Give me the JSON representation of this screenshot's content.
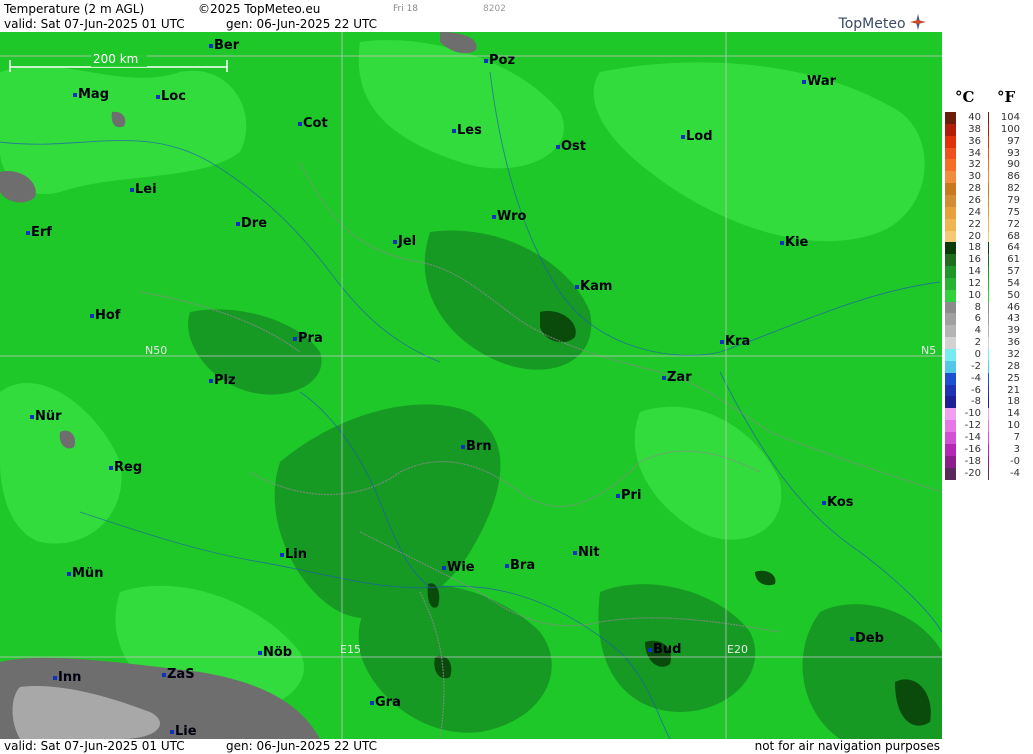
{
  "header": {
    "title": "Temperature (2 m AGL)",
    "copyright": "©2025 TopMeteo.eu",
    "day_tag": "Fri 18",
    "code": "8202",
    "valid": "valid:  Sat  07-Jun-2025  01 UTC",
    "generated": "gen: 06-Jun-2025 22 UTC",
    "brand": "TopMeteo"
  },
  "footer": {
    "valid": "valid:  Sat  07-Jun-2025  01 UTC",
    "generated": "gen: 06-Jun-2025 22 UTC",
    "disclaimer": "not for air navigation purposes"
  },
  "map": {
    "scale_label": "200 km",
    "grid_labels": {
      "lat": "N50",
      "lat_right": "N5",
      "lon1": "E15",
      "lon2": "E20"
    },
    "cities": [
      "Ber",
      "Poz",
      "War",
      "Mag",
      "Loc",
      "Cot",
      "Les",
      "Ost",
      "Lod",
      "Lei",
      "Dre",
      "Wro",
      "Erf",
      "Jel",
      "Kie",
      "Kam",
      "Hof",
      "Pra",
      "Kra",
      "Plz",
      "Zar",
      "Nür",
      "Brn",
      "Reg",
      "Pri",
      "Kos",
      "Lin",
      "Nit",
      "Mün",
      "Wie",
      "Bra",
      "Nöb",
      "Bud",
      "Deb",
      "Inn",
      "ZaS",
      "Gra",
      "Lie"
    ]
  },
  "legend": {
    "unit_c": "°C",
    "unit_f": "°F",
    "celsius": [
      "40",
      "38",
      "36",
      "34",
      "32",
      "30",
      "28",
      "26",
      "24",
      "22",
      "20",
      "18",
      "16",
      "14",
      "12",
      "10",
      "8",
      "6",
      "4",
      "2",
      "0",
      "-2",
      "-4",
      "-6",
      "-8",
      "-10",
      "-12",
      "-14",
      "-16",
      "-18",
      "-20"
    ],
    "fahrenheit": [
      "104",
      "100",
      "97",
      "93",
      "90",
      "86",
      "82",
      "79",
      "75",
      "72",
      "68",
      "64",
      "61",
      "57",
      "54",
      "50",
      "46",
      "43",
      "39",
      "36",
      "32",
      "28",
      "25",
      "21",
      "18",
      "14",
      "10",
      "7",
      "3",
      "-0",
      "-4"
    ],
    "colors": [
      "#6b1e0a",
      "#b01e0a",
      "#e0320a",
      "#f0501e",
      "#f56e28",
      "#f08c3c",
      "#c8781e",
      "#d28c32",
      "#e6a03c",
      "#f0b450",
      "#f5c878",
      "#0a3c0a",
      "#1e6e1e",
      "#1e9628",
      "#28b432",
      "#32d23c",
      "#8c8c8c",
      "#a0a0a0",
      "#b4b4b4",
      "#d2d2d2",
      "#78ebf0",
      "#50c8e6",
      "#1e50d2",
      "#1e32b4",
      "#1e1e96",
      "#f0a0f0",
      "#e678e6",
      "#d250d2",
      "#b428b4",
      "#8c1e8c",
      "#5a285a"
    ]
  }
}
